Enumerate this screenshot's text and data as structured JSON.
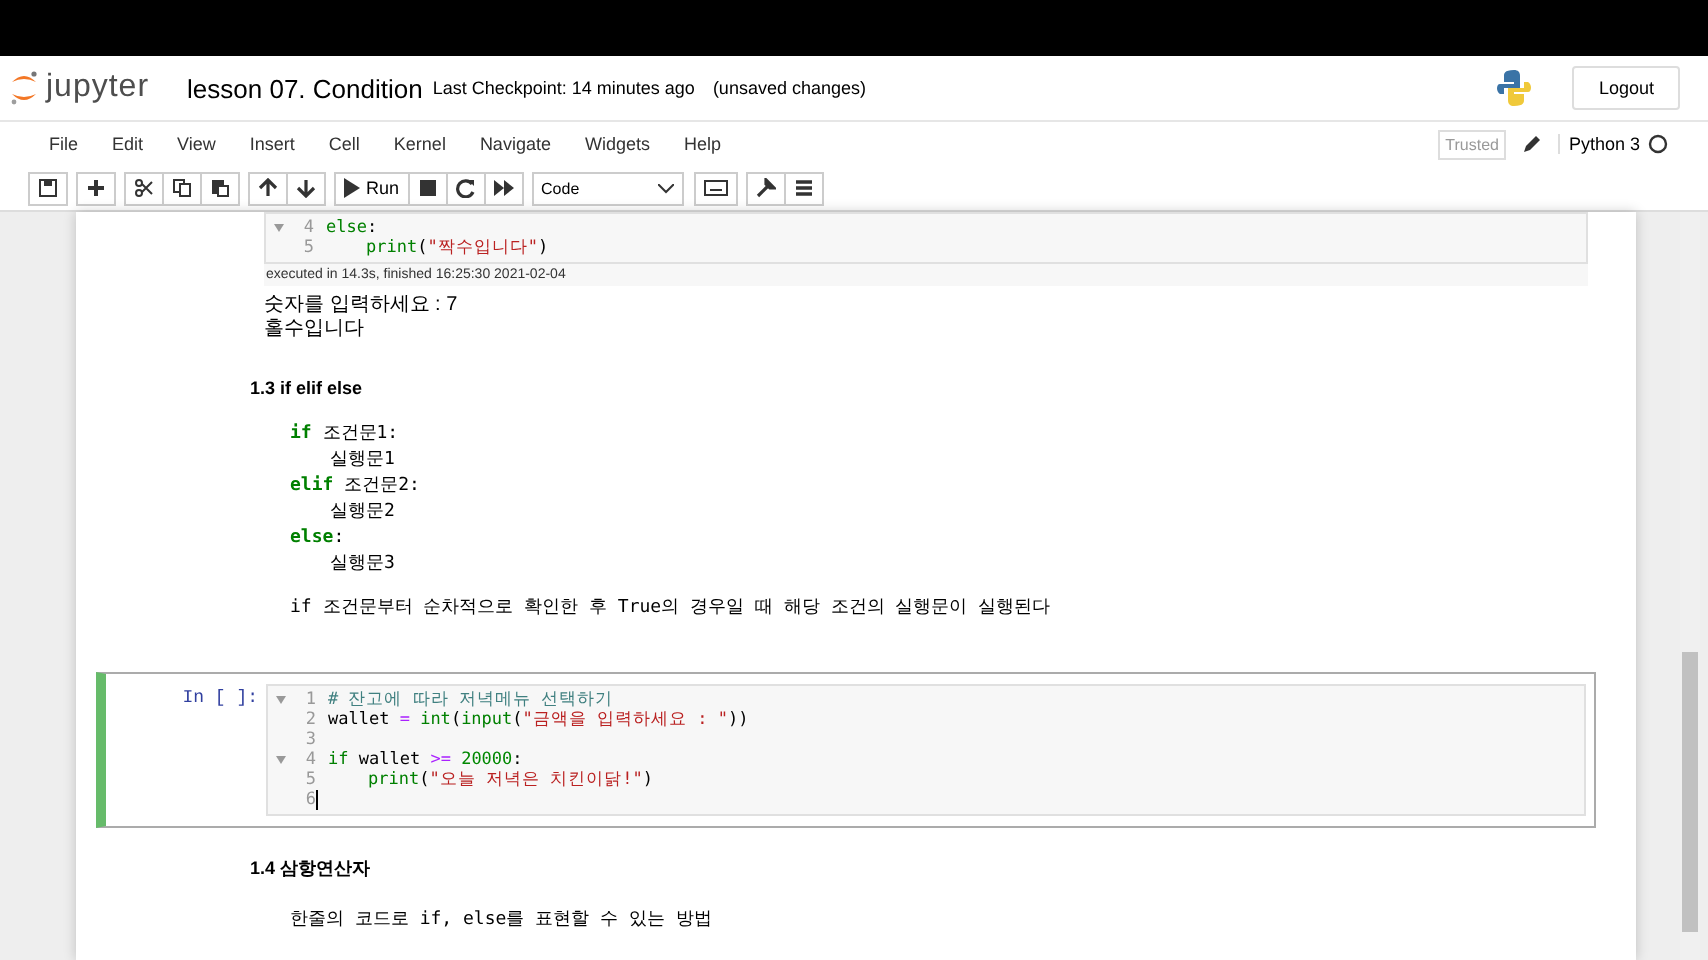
{
  "header": {
    "logo_text": "jupyter",
    "notebook_title": "lesson 07. Condition",
    "checkpoint": "Last Checkpoint: 14 minutes ago",
    "unsaved": "(unsaved changes)",
    "logout": "Logout"
  },
  "menu": {
    "items": [
      "File",
      "Edit",
      "View",
      "Insert",
      "Cell",
      "Kernel",
      "Navigate",
      "Widgets",
      "Help"
    ],
    "trusted": "Trusted",
    "kernel": "Python 3"
  },
  "toolbar": {
    "run_label": "Run",
    "cell_type": "Code"
  },
  "cells": [
    {
      "kind": "code",
      "lines": [
        {
          "number": "4",
          "fold": true,
          "indent": false,
          "tokens": [
            {
              "kind": "kw",
              "text": "else"
            },
            {
              "kind": "plain",
              "text": ":"
            }
          ]
        },
        {
          "number": "5",
          "fold": false,
          "indent": true,
          "tokens": [
            {
              "kind": "builtin",
              "text": "print"
            },
            {
              "kind": "plain",
              "text": "("
            },
            {
              "kind": "str",
              "text": "\"짝수입니다\""
            },
            {
              "kind": "plain",
              "text": ")"
            }
          ]
        }
      ],
      "timing": "executed in 14.3s, finished 16:25:30 2021-02-04",
      "output": [
        "숫자를 입력하세요 : 7",
        "홀수입니다"
      ],
      "selected": false
    },
    {
      "kind": "markdown",
      "heading": "1.3  if elif else",
      "code": [
        {
          "indent": false,
          "tokens": [
            {
              "kind": "kw",
              "text": "if"
            },
            {
              "kind": "plain",
              "text": " 조건문1:"
            }
          ]
        },
        {
          "indent": true,
          "tokens": [
            {
              "kind": "plain",
              "text": "실행문1"
            }
          ]
        },
        {
          "indent": false,
          "tokens": [
            {
              "kind": "kw",
              "text": "elif"
            },
            {
              "kind": "plain",
              "text": " 조건문2:"
            }
          ]
        },
        {
          "indent": true,
          "tokens": [
            {
              "kind": "plain",
              "text": "실행문2"
            }
          ]
        },
        {
          "indent": false,
          "tokens": [
            {
              "kind": "kw",
              "text": "else"
            },
            {
              "kind": "plain",
              "text": ":"
            }
          ]
        },
        {
          "indent": true,
          "tokens": [
            {
              "kind": "plain",
              "text": "실행문3"
            }
          ]
        }
      ],
      "paragraph": "if 조건문부터 순차적으로 확인한 후 True의 경우일 때 해당 조건의 실행문이 실행된다"
    },
    {
      "kind": "code",
      "prompt": "In [ ]:",
      "lines": [
        {
          "number": "1",
          "fold": true,
          "indent": false,
          "tokens": [
            {
              "kind": "comment",
              "text": "# 잔고에 따라 저녁메뉴 선택하기"
            }
          ]
        },
        {
          "number": "2",
          "fold": false,
          "indent": false,
          "tokens": [
            {
              "kind": "plain",
              "text": "wallet "
            },
            {
              "kind": "op",
              "text": "="
            },
            {
              "kind": "builtin",
              "text": " int"
            },
            {
              "kind": "plain",
              "text": "("
            },
            {
              "kind": "builtin",
              "text": "input"
            },
            {
              "kind": "plain",
              "text": "("
            },
            {
              "kind": "str",
              "text": "\"금액을 입력하세요 : \""
            },
            {
              "kind": "plain",
              "text": "))"
            }
          ]
        },
        {
          "number": "3",
          "fold": false
        },
        {
          "number": "4",
          "fold": true,
          "indent": false,
          "tokens": [
            {
              "kind": "kw",
              "text": "if"
            },
            {
              "kind": "plain",
              "text": " wallet "
            },
            {
              "kind": "op",
              "text": ">="
            },
            {
              "kind": "num",
              "text": " 20000"
            },
            {
              "kind": "plain",
              "text": ":"
            }
          ]
        },
        {
          "number": "5",
          "fold": false,
          "indent": true,
          "tokens": [
            {
              "kind": "builtin",
              "text": "print"
            },
            {
              "kind": "plain",
              "text": "("
            },
            {
              "kind": "str",
              "text": "\"오늘 저녁은 치킨이닭!\""
            },
            {
              "kind": "plain",
              "text": ")"
            }
          ]
        },
        {
          "number": "6",
          "fold": false
        }
      ],
      "selected": true
    },
    {
      "kind": "markdown",
      "heading": "1.4  삼항연산자",
      "paragraph": "한줄의 코드로 if, else를 표현할 수 있는 방법"
    }
  ]
}
